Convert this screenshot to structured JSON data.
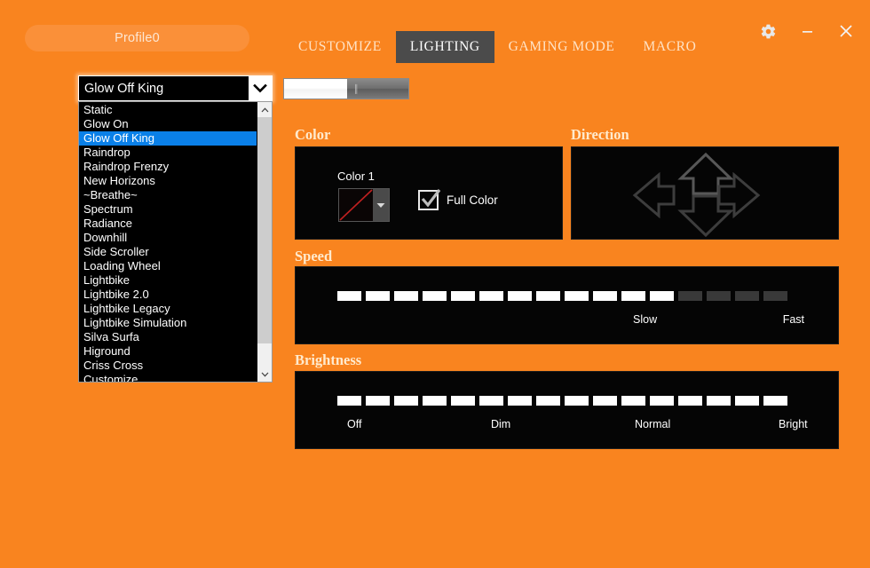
{
  "titlebar": {
    "profile_label": "Profile0",
    "tabs": [
      {
        "label": "CUSTOMIZE",
        "active": false
      },
      {
        "label": "LIGHTING",
        "active": true
      },
      {
        "label": "GAMING MODE",
        "active": false
      },
      {
        "label": "MACRO",
        "active": false
      }
    ],
    "window_controls": {
      "settings": "gear-icon",
      "minimize": "minimize-icon",
      "close": "close-icon"
    }
  },
  "mode_selector": {
    "selected": "Glow Off King",
    "options": [
      "Static",
      "Glow On",
      "Glow Off King",
      "Raindrop",
      "Raindrop Frenzy",
      "New Horizons",
      "~Breathe~",
      "Spectrum",
      "Radiance",
      "Downhill",
      "Side Scroller",
      "Loading Wheel",
      "Lightbike",
      "Lightbike 2.0",
      "Lightbike Legacy",
      "Lightbike Simulation",
      "Silva Surfa",
      "Higround",
      "Criss Cross",
      "Customize"
    ]
  },
  "color_section": {
    "title": "Color",
    "color_1_label": "Color 1",
    "color_1_value": "none",
    "full_color_label": "Full Color",
    "full_color_checked": true
  },
  "direction_section": {
    "title": "Direction",
    "arrows": [
      "up",
      "down",
      "left",
      "right"
    ],
    "selected": "none"
  },
  "speed_section": {
    "title": "Speed",
    "min_label": "Slow",
    "max_label": "Fast",
    "total_segments": 16,
    "filled_segments": 12
  },
  "brightness_section": {
    "title": "Brightness",
    "labels": [
      "Off",
      "Dim",
      "Normal",
      "Bright"
    ],
    "total_segments": 16,
    "filled_segments": 16
  },
  "colors": {
    "background": "#f9841f",
    "panel": "#050505",
    "accent_tab": "#4b4b4b",
    "highlight": "#0a80e8",
    "segment_on": "#ffffff",
    "segment_off": "#393939"
  }
}
